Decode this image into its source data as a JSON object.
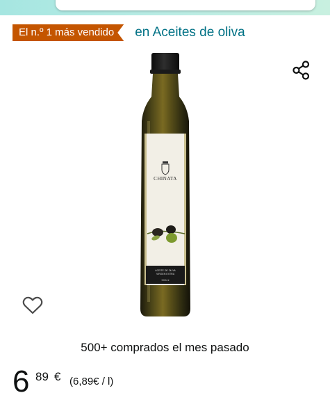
{
  "header": {
    "search_bar_icon": "search-field"
  },
  "bestseller": {
    "badge_label": "El n.º 1 más vendido",
    "category_link": "en Aceites de oliva",
    "badge_color": "#c45500",
    "link_color": "#007185"
  },
  "product": {
    "image_icon": "olive-oil-bottle",
    "label_brand": "CHINATA",
    "label_line1": "ACEITE DE OLIVA",
    "label_line2": "VIRGEN EXTRA",
    "label_volume": "500ml",
    "share_icon": "share-icon",
    "wishlist_icon": "heart-icon"
  },
  "purchases": {
    "text": "500+ comprados el mes pasado"
  },
  "price": {
    "whole": "6",
    "fraction": "89",
    "currency": "€",
    "unit_price": "(6,89€ / l)"
  }
}
